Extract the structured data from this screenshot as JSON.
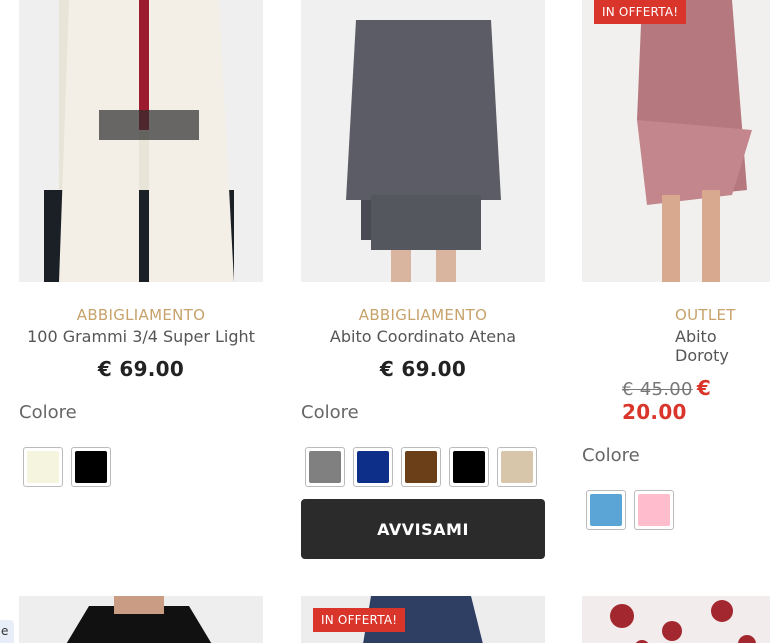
{
  "products": [
    {
      "category": "ABBIGLIAMENTO",
      "title": "100 Grammi 3/4 Super Light",
      "price": "€ 69.00",
      "colore_label": "Colore",
      "swatches": [
        "#f4f4df",
        "#000000"
      ]
    },
    {
      "category": "ABBIGLIAMENTO",
      "title": "Abito Coordinato Atena",
      "price": "€ 69.00",
      "colore_label": "Colore",
      "swatches": [
        "#808080",
        "#0d2f8a",
        "#6b4018",
        "#000000",
        "#d8c6ab"
      ],
      "button_label": "AVVISAMI"
    },
    {
      "category": "OUTLET",
      "title": "Abito Doroty",
      "old_price": "€ 45.00",
      "price": "€ 20.00",
      "badge": "IN OFFERTA!",
      "colore_label": "Colore",
      "swatches": [
        "#5ba5d6",
        "#ffbccd"
      ]
    }
  ],
  "row2": {
    "badge": "IN OFFERTA!"
  },
  "edge_tab": "e"
}
